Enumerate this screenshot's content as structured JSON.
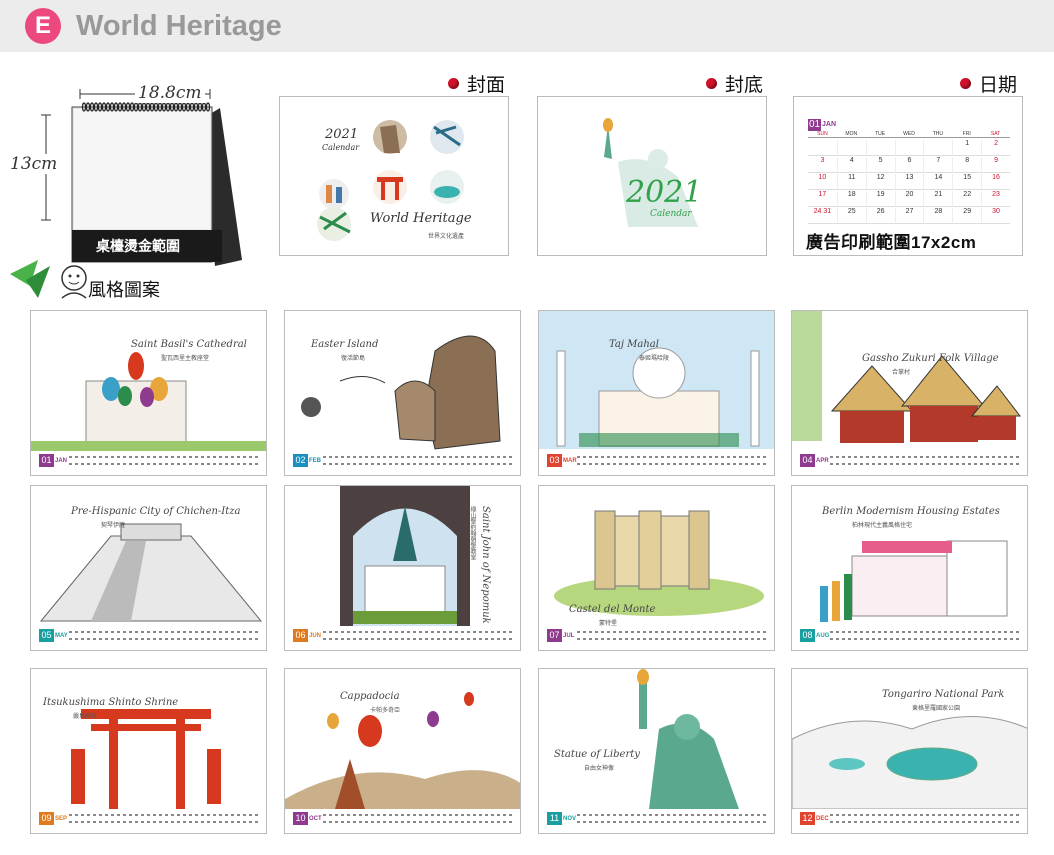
{
  "header": {
    "badge": "E",
    "title": "World Heritage"
  },
  "sections": {
    "cover": "封面",
    "back": "封底",
    "date": "日期"
  },
  "calendar_stand": {
    "width": "18.8cm",
    "height": "13cm",
    "imprint": "桌檯燙金範圍"
  },
  "cover_panel": {
    "year": "2021",
    "sub": "Calendar",
    "name": "World Heritage",
    "name_cn": "世界文化遺產"
  },
  "back_panel": {
    "year": "2021",
    "sub": "Calendar"
  },
  "date_panel": {
    "month_num": "01",
    "month": "JAN",
    "weekdays": [
      "SUN",
      "MON",
      "TUE",
      "WED",
      "THU",
      "FRI",
      "SAT"
    ],
    "weeks": [
      [
        "",
        "",
        "",
        "",
        "",
        "1",
        "2"
      ],
      [
        "3",
        "4",
        "5",
        "6",
        "7",
        "8",
        "9"
      ],
      [
        "10",
        "11",
        "12",
        "13",
        "14",
        "15",
        "16"
      ],
      [
        "17",
        "18",
        "19",
        "20",
        "21",
        "22",
        "23"
      ],
      [
        "24 31",
        "25",
        "26",
        "27",
        "28",
        "29",
        "30"
      ]
    ],
    "ad_caption": "廣告印刷範圍17x2cm"
  },
  "style_section": {
    "title": "風格圖案"
  },
  "months": [
    {
      "num": "01",
      "name": "JAN",
      "color": "#8e3a8e",
      "title": "Saint Basil's Cathedral",
      "sub": "聖瓦西里主教座堂"
    },
    {
      "num": "02",
      "name": "FEB",
      "color": "#1a8fc0",
      "title": "Easter Island",
      "sub": "復活節島"
    },
    {
      "num": "03",
      "name": "MAR",
      "color": "#e0442e",
      "title": "Taj Mahal",
      "sub": "泰姬瑪哈陵"
    },
    {
      "num": "04",
      "name": "APR",
      "color": "#8e3a8e",
      "title": "Gassho Zukuri Folk Village",
      "sub": "合掌村"
    },
    {
      "num": "05",
      "name": "MAY",
      "color": "#1a9fa0",
      "title": "Pre-Hispanic City of Chichen-Itza",
      "sub": "契琴伊薩"
    },
    {
      "num": "06",
      "name": "JUN",
      "color": "#e07a1f",
      "title": "Saint John of Nepomuk",
      "sub": "綠山聖約翰朝聖教堂"
    },
    {
      "num": "07",
      "name": "JUL",
      "color": "#8e3a8e",
      "title": "Castel del Monte",
      "sub": "蒙特堡"
    },
    {
      "num": "08",
      "name": "AUG",
      "color": "#1a9fa0",
      "title": "Berlin Modernism Housing Estates",
      "sub": "柏林現代主義風格住宅"
    },
    {
      "num": "09",
      "name": "SEP",
      "color": "#e07a1f",
      "title": "Itsukushima Shinto Shrine",
      "sub": "嚴島神社"
    },
    {
      "num": "10",
      "name": "OCT",
      "color": "#8e3a8e",
      "title": "Cappadocia",
      "sub": "卡帕多奇亞"
    },
    {
      "num": "11",
      "name": "NOV",
      "color": "#1a9fa0",
      "title": "Statue of Liberty",
      "sub": "自由女神像"
    },
    {
      "num": "12",
      "name": "DEC",
      "color": "#e0442e",
      "title": "Tongariro National Park",
      "sub": "東格里羅國家公園"
    }
  ]
}
